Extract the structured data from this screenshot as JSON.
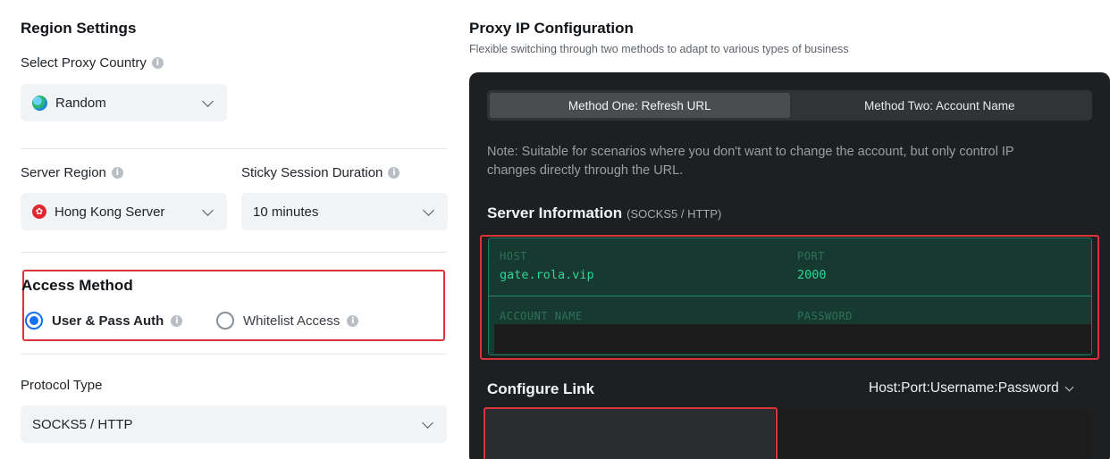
{
  "region_settings": {
    "title": "Region Settings",
    "country_label": "Select Proxy Country",
    "country_value": "Random",
    "server_region_label": "Server Region",
    "server_region_value": "Hong Kong Server",
    "sticky_label": "Sticky Session Duration",
    "sticky_value": "10 minutes",
    "access_title": "Access Method",
    "access_options": [
      "User & Pass Auth",
      "Whitelist Access"
    ],
    "access_selected": "User & Pass Auth",
    "protocol_label": "Protocol Type",
    "protocol_value": "SOCKS5 / HTTP"
  },
  "proxy_config": {
    "title": "Proxy IP Configuration",
    "subtitle": "Flexible switching through two methods to adapt to various types of business",
    "tabs": [
      "Method One: Refresh URL",
      "Method Two: Account Name"
    ],
    "active_tab": "Method One: Refresh URL",
    "note": "Note: Suitable for scenarios where you don't want to change the account, but only control IP changes directly through the URL.",
    "server_info_title": "Server Information",
    "server_info_sub": "(SOCKS5 / HTTP)",
    "host_label": "HOST",
    "host_value": "gate.rola.vip",
    "port_label": "PORT",
    "port_value": "2000",
    "account_label": "ACCOUNT NAME",
    "password_label": "PASSWORD",
    "configure_title": "Configure Link",
    "link_format": "Host:Port:Username:Password"
  },
  "icons": {
    "info": "info-icon",
    "country": "globe-icon",
    "region": "hong-kong-flag-icon",
    "dropdown": "chevron-down-icon"
  },
  "colors": {
    "accent": "#1570ef",
    "highlight_border": "#d8343a",
    "server_text": "#2fd49a",
    "panel_bg": "#1e1f21"
  }
}
